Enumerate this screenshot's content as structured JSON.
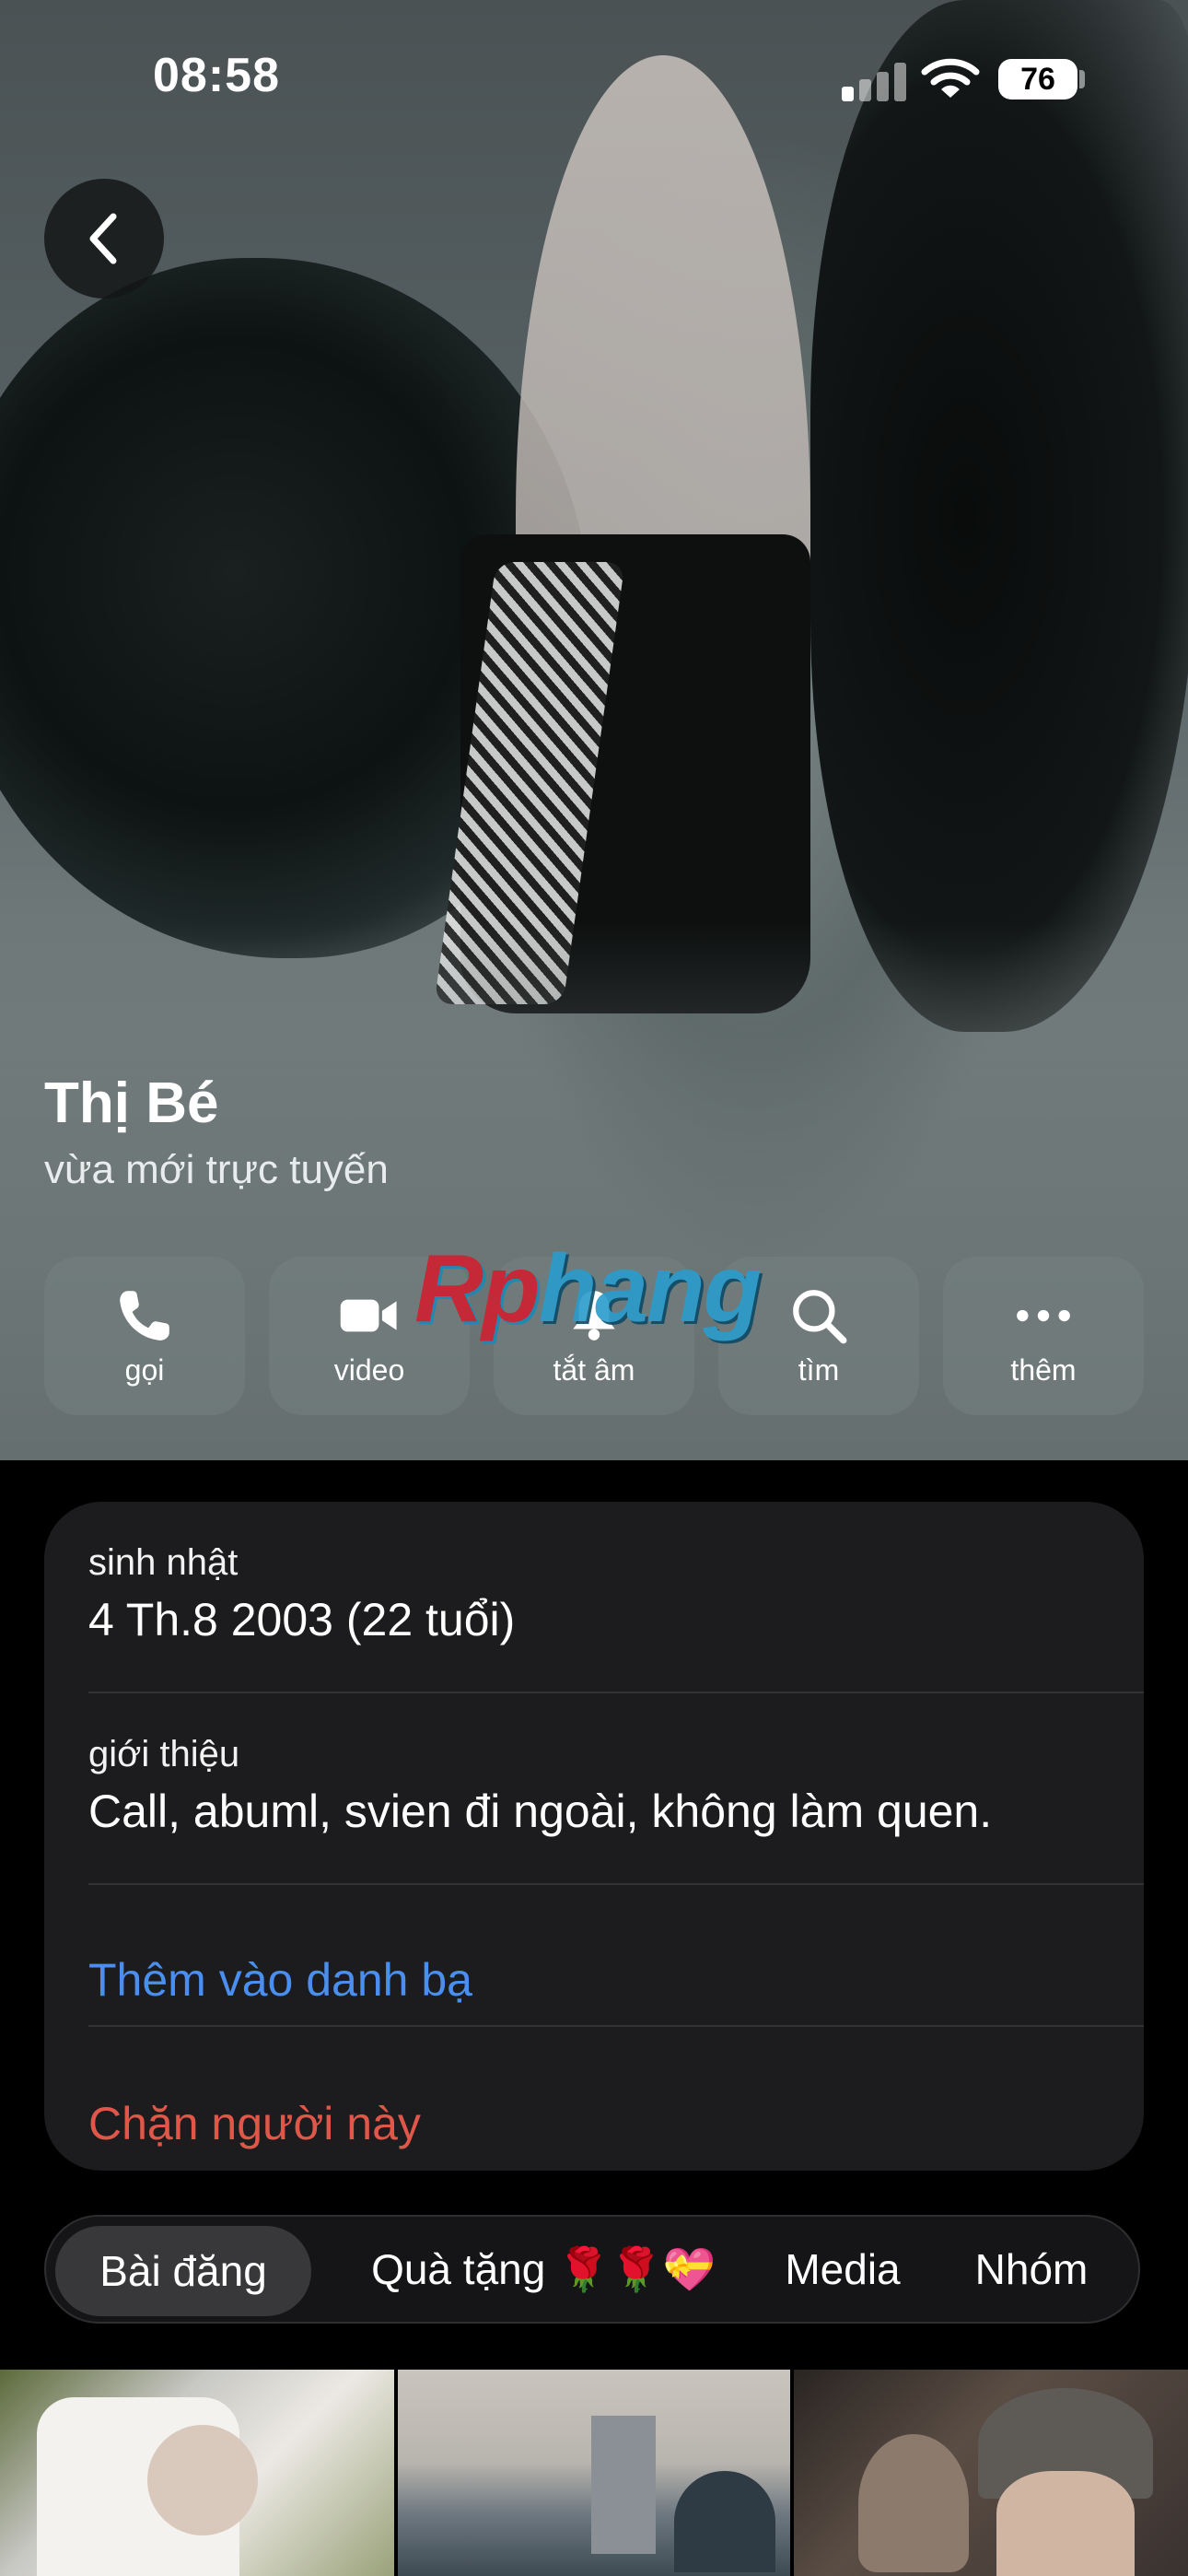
{
  "status_bar": {
    "time": "08:58",
    "battery": "76"
  },
  "profile": {
    "name": "Thị Bé",
    "status": "vừa mới trực tuyến"
  },
  "actions": [
    {
      "label": "gọi",
      "icon": "phone-icon"
    },
    {
      "label": "video",
      "icon": "video-camera-icon"
    },
    {
      "label": "tắt âm",
      "icon": "bell-icon"
    },
    {
      "label": "tìm",
      "icon": "search-icon"
    },
    {
      "label": "thêm",
      "icon": "more-dots-icon"
    }
  ],
  "watermark": {
    "part1": "Rp",
    "part2": "hang"
  },
  "info": {
    "birthday_label": "sinh nhật",
    "birthday_value": "4 Th.8 2003 (22 tuổi)",
    "bio_label": "giới thiệu",
    "bio_value": "Call, abuml, svien đi ngoài, không làm quen.",
    "add_contact": "Thêm vào danh bạ",
    "block": "Chặn người này"
  },
  "tabs": [
    {
      "label": "Bài đăng",
      "active": true
    },
    {
      "label": "Quà tặng 🌹🌹💝",
      "active": false
    },
    {
      "label": "Media",
      "active": false
    },
    {
      "label": "Nhóm",
      "active": false
    }
  ],
  "colors": {
    "link_blue": "#4a8ef0",
    "destructive_red": "#e0574a",
    "card_bg": "#1c1c1e"
  }
}
